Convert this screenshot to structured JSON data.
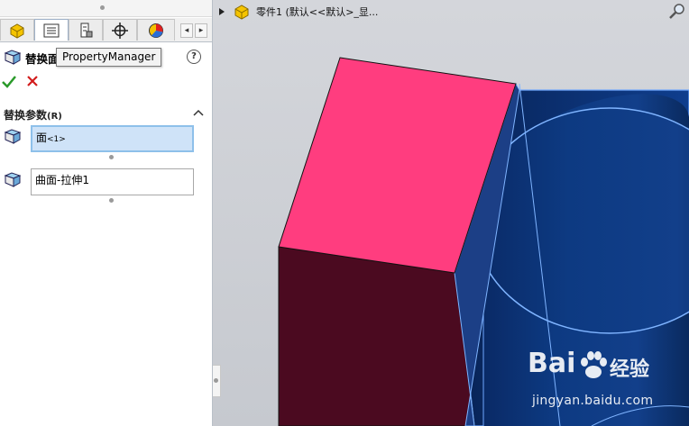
{
  "property_manager": {
    "title": "替换面",
    "tooltip": "PropertyManager",
    "help_glyph": "?",
    "section": {
      "title": "替换参数",
      "title_suffix": "(R)",
      "fields": [
        {
          "label": "面",
          "suffix": "<1>",
          "active": true
        },
        {
          "label": "曲面-拉伸1",
          "suffix": "",
          "active": false
        }
      ]
    }
  },
  "graphics": {
    "tree_label": "零件1  (默认<<默认>_显...",
    "colors": {
      "top_face": "#ff3d7f",
      "side_face": "#4b0a20",
      "cylinder": "#0d3f8c"
    }
  },
  "watermark": {
    "brand": "Bai",
    "site": "经验",
    "url": "jingyan.baidu.com"
  }
}
